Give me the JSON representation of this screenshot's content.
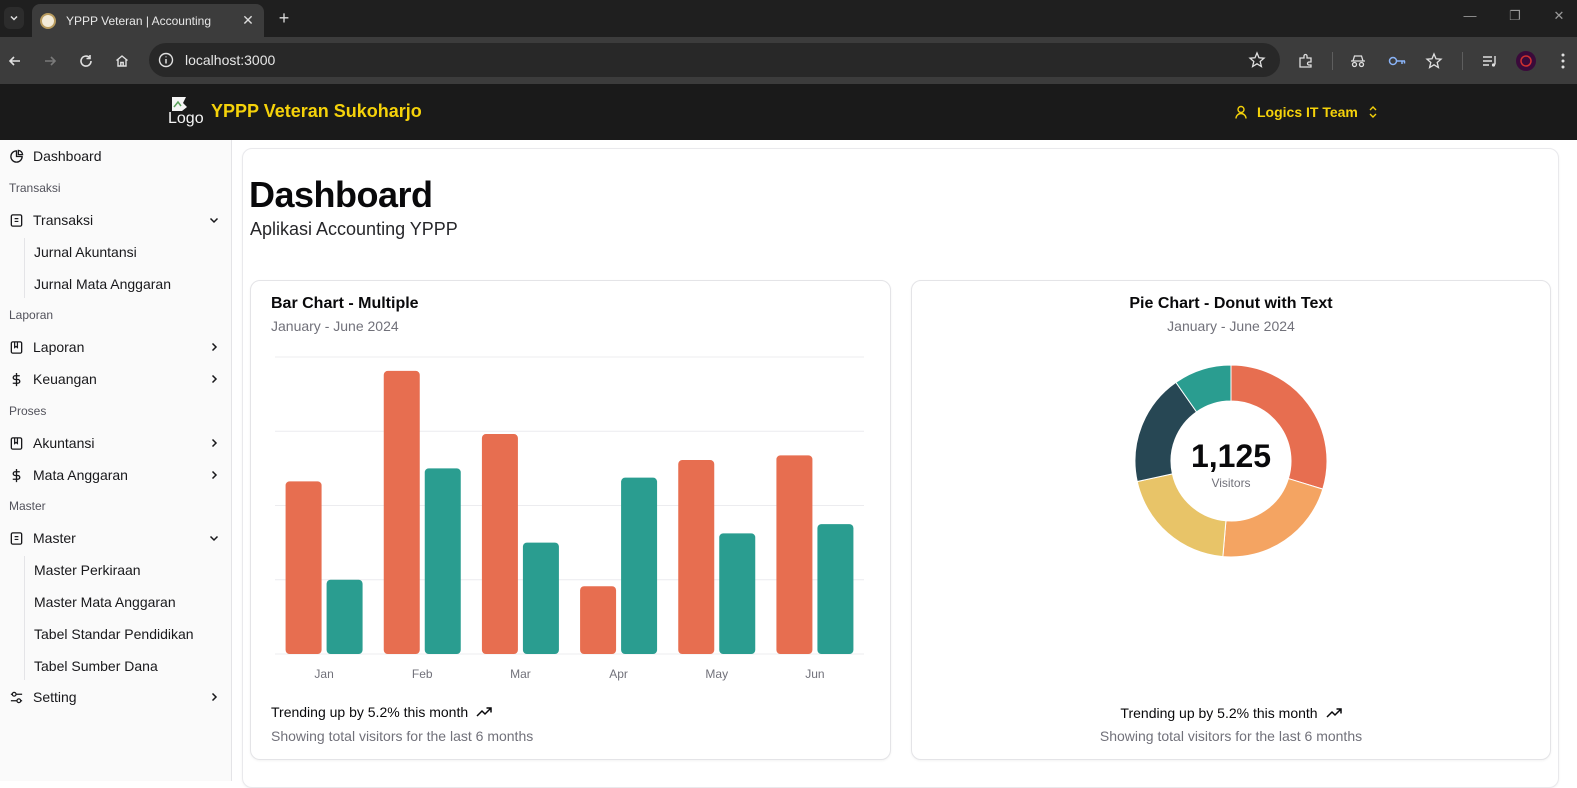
{
  "browser": {
    "tab_title": "YPPP Veteran | Accounting",
    "url": "localhost:3000"
  },
  "header": {
    "logo_alt": "Logo",
    "app_title": "YPPP Veteran Sukoharjo",
    "user_name": "Logics IT Team"
  },
  "sidebar": {
    "dashboard": "Dashboard",
    "group_transaksi": "Transaksi",
    "transaksi": "Transaksi",
    "jurnal_akuntansi": "Jurnal Akuntansi",
    "jurnal_mata_anggaran": "Jurnal Mata Anggaran",
    "group_laporan": "Laporan",
    "laporan": "Laporan",
    "keuangan": "Keuangan",
    "group_proses": "Proses",
    "akuntansi": "Akuntansi",
    "mata_anggaran": "Mata Anggaran",
    "group_master": "Master",
    "master": "Master",
    "master_perkiraan": "Master Perkiraan",
    "master_mata_anggaran": "Master Mata Anggaran",
    "tabel_standar": "Tabel Standar Pendidikan",
    "tabel_sumber_dana": "Tabel Sumber Dana",
    "setting": "Setting"
  },
  "page": {
    "title": "Dashboard",
    "subtitle": "Aplikasi Accounting YPPP"
  },
  "bar_card": {
    "title": "Bar Chart - Multiple",
    "description": "January - June 2024",
    "footer_main": "Trending up by 5.2% this month",
    "footer_sub": "Showing total visitors for the last 6 months"
  },
  "pie_card": {
    "title": "Pie Chart - Donut with Text",
    "description": "January - June 2024",
    "center_value": "1,125",
    "center_label": "Visitors",
    "footer_main": "Trending up by 5.2% this month",
    "footer_sub": "Showing total visitors for the last 6 months"
  },
  "colors": {
    "accent_yellow": "#f5d20a",
    "series_1": "#e76e50",
    "series_2": "#2a9d90",
    "pie_1": "#e76e50",
    "pie_2": "#f4a462",
    "pie_3": "#e8c468",
    "pie_4": "#274754",
    "pie_5": "#2a9d90"
  },
  "chart_data": [
    {
      "type": "bar",
      "title": "Bar Chart - Multiple",
      "categories": [
        "Jan",
        "Feb",
        "Mar",
        "Apr",
        "May",
        "Jun"
      ],
      "series": [
        {
          "values": [
            186,
            305,
            237,
            73,
            209,
            214
          ]
        },
        {
          "values": [
            80,
            200,
            120,
            190,
            130,
            140
          ]
        }
      ],
      "ylim": [
        0,
        320
      ],
      "grid": true
    },
    {
      "type": "pie",
      "title": "Pie Chart - Donut with Text",
      "labels": [],
      "values": [
        275,
        200,
        187,
        173,
        90
      ],
      "total": 1125
    }
  ]
}
